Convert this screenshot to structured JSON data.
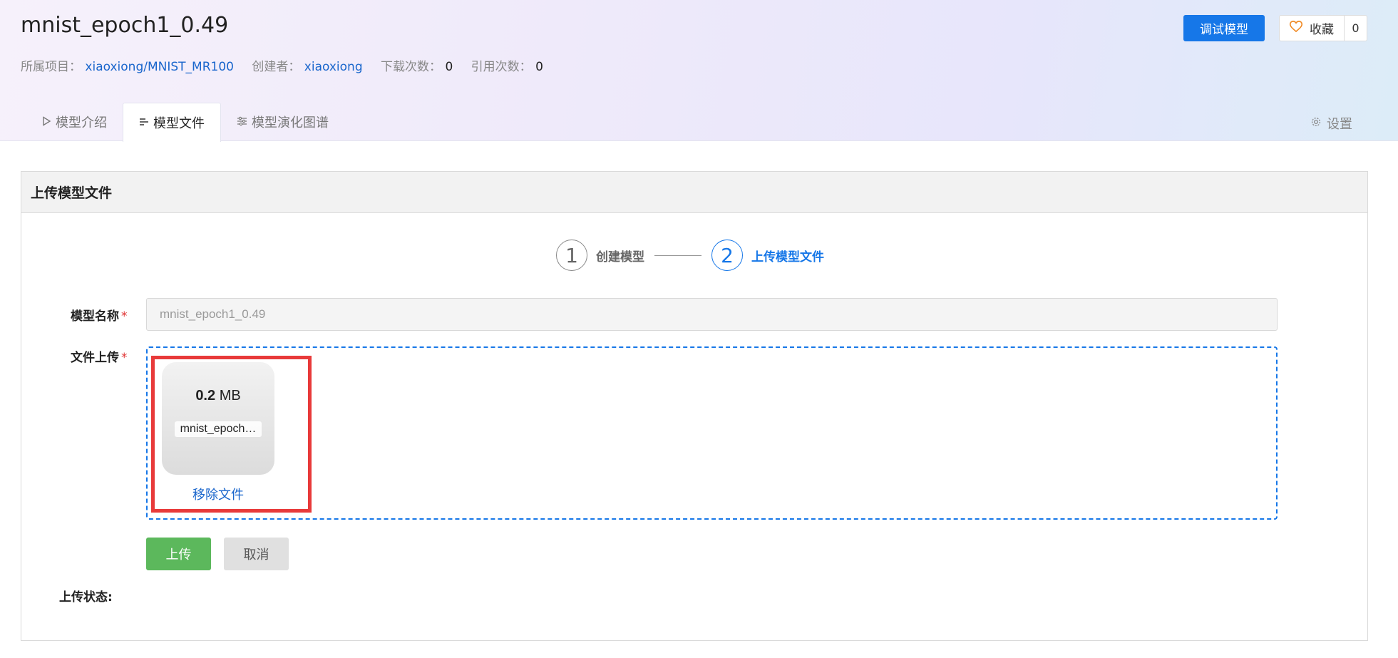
{
  "model": {
    "title": "mnist_epoch1_0.49",
    "project_label": "所属项目：",
    "project": "xiaoxiong/MNIST_MR100",
    "creator_label": "创建者：",
    "creator": "xiaoxiong",
    "downloads_label": "下载次数：",
    "downloads": "0",
    "citations_label": "引用次数：",
    "citations": "0"
  },
  "actions": {
    "debug_label": "调试模型",
    "fav_label": "收藏",
    "fav_count": "0"
  },
  "tabs": [
    {
      "label": "模型介绍",
      "icon": "play-icon",
      "active": false
    },
    {
      "label": "模型文件",
      "icon": "list-icon",
      "active": true
    },
    {
      "label": "模型演化图谱",
      "icon": "sliders-icon",
      "active": false
    }
  ],
  "settings_label": "设置",
  "panel": {
    "title": "上传模型文件",
    "steps": [
      {
        "num": "1",
        "label": "创建模型"
      },
      {
        "num": "2",
        "label": "上传模型文件"
      }
    ],
    "name_label": "模型名称",
    "name_value": "mnist_epoch1_0.49",
    "file_label": "文件上传",
    "file": {
      "size_value": "0.2",
      "size_unit": "MB",
      "name": "mnist_epoch…",
      "remove_label": "移除文件"
    },
    "upload_button": "上传",
    "cancel_button": "取消",
    "status_label": "上传状态:",
    "required_mark": "*"
  },
  "colors": {
    "primary": "#1677e8",
    "success": "#5cb85c",
    "highlight": "#e83a3a",
    "link": "#1a66cc"
  }
}
